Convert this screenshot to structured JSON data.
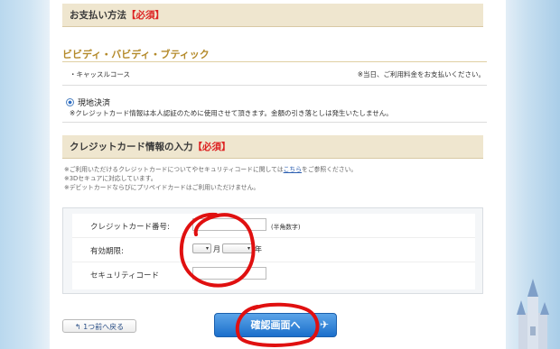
{
  "payment": {
    "heading": "お支払い方法",
    "required": "【必須】",
    "shop_name": "ビビディ・バビディ・ブティック",
    "course": "・キャッスルコース",
    "course_note": "※当日、ご利用料金をお支払いください。",
    "method_label": "現地決済",
    "method_note": "※クレジットカード情報は本人認証のために使用させて頂きます。金額の引き落としは発生いたしません。"
  },
  "credit": {
    "heading": "クレジットカード情報の入力",
    "required": "【必須】",
    "info1_prefix": "※ご利用いただけるクレジットカードについてやセキュリティコードに関しては",
    "info1_link": "こちら",
    "info1_suffix": "をご参照ください。",
    "info2": "※3Dセキュアに対応しています。",
    "info3": "※デビットカードならびにプリペイドカードはご利用いただけません。",
    "form": {
      "card_number_label": "クレジットカード番号:",
      "card_number_hint": "(半角数字)",
      "expiry_label": "有効期限:",
      "month_suffix": "月",
      "year_suffix": "年",
      "security_label": "セキュリティコード"
    }
  },
  "buttons": {
    "back": "1つ前へ戻る",
    "confirm": "確認画面へ"
  },
  "colors": {
    "required": "#dd2222",
    "shop_name": "#b48a2a",
    "confirm_button": "#1b6fcb",
    "annotation_red": "#e01010"
  }
}
